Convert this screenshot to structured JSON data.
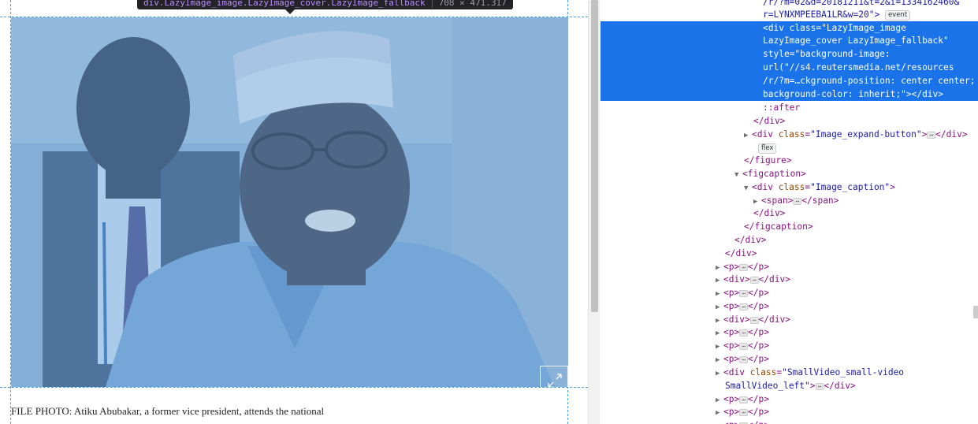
{
  "tooltip": {
    "selector": "div.LazyImage_image.LazyImage_cover.LazyImage_fallback",
    "dimensions": "708 × 471.317"
  },
  "caption": {
    "text": "FILE PHOTO: Atiku Abubakar, a former vice president, attends the national"
  },
  "photo": {
    "overlay_color": "#6fa8dc",
    "expand_icon": "expand-arrows-icon"
  },
  "devtools": {
    "top_lines": [
      "/r/?m=02&d=20181211&t=2&i=1334162460&",
      "r=LYNXMPEEBA1LR&w=20\">"
    ],
    "event_badge": "event",
    "selected": {
      "line1": "<div class=\"LazyImage_image",
      "line2": "LazyImage_cover LazyImage_fallback\"",
      "line3": "style=\"background-image:",
      "line4": "url(\"//s4.reutersmedia.net/resources",
      "line5": "/r/?m=…ckground-position: center center;",
      "line6": "background-color: inherit;\"></div>"
    },
    "after": "::after",
    "close_div": "</div>",
    "expand_button": {
      "open": "<div ",
      "attr": "class",
      "value": "\"Image_expand-button\"",
      "close": ">",
      "end": "</div>"
    },
    "flex_badge": "flex",
    "close_figure": "</figure>",
    "figcaption_open": "<figcaption>",
    "caption_div": {
      "open": "<div ",
      "attr": "class",
      "value": "\"Image_caption\"",
      "close": ">"
    },
    "span_open": "<span>",
    "span_close": "</span>",
    "close_figcaption": "</figcaption>",
    "p_open": "<p>",
    "p_close": "</p>",
    "div_open": "<div>",
    "smallvideo": {
      "open": "<div ",
      "attr": "class",
      "value1": "\"SmallVideo_small-video",
      "value2": "SmallVideo_left\"",
      "close": ">",
      "end": "</div>"
    },
    "ellipsis": "⋯"
  }
}
